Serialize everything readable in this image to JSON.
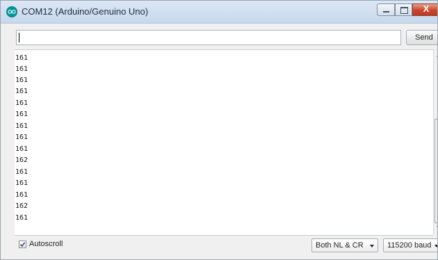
{
  "window": {
    "title": "COM12 (Arduino/Genuino Uno)",
    "accent": "#00979c",
    "close_glyph": "X"
  },
  "input": {
    "value": "",
    "send_label": "Send"
  },
  "output": {
    "lines": [
      "161",
      "161",
      "161",
      "161",
      "161",
      "161",
      "161",
      "161",
      "161",
      "162",
      "161",
      "161",
      "161",
      "162",
      "161"
    ]
  },
  "footer": {
    "autoscroll_label": "Autoscroll",
    "autoscroll_checked": true,
    "line_ending": "Both NL & CR",
    "baud_rate": "115200 baud"
  },
  "icons": [
    "arduino-logo-icon",
    "minimize-icon",
    "maximize-icon",
    "close-icon",
    "checkmark-icon",
    "chevron-down-icon"
  ]
}
